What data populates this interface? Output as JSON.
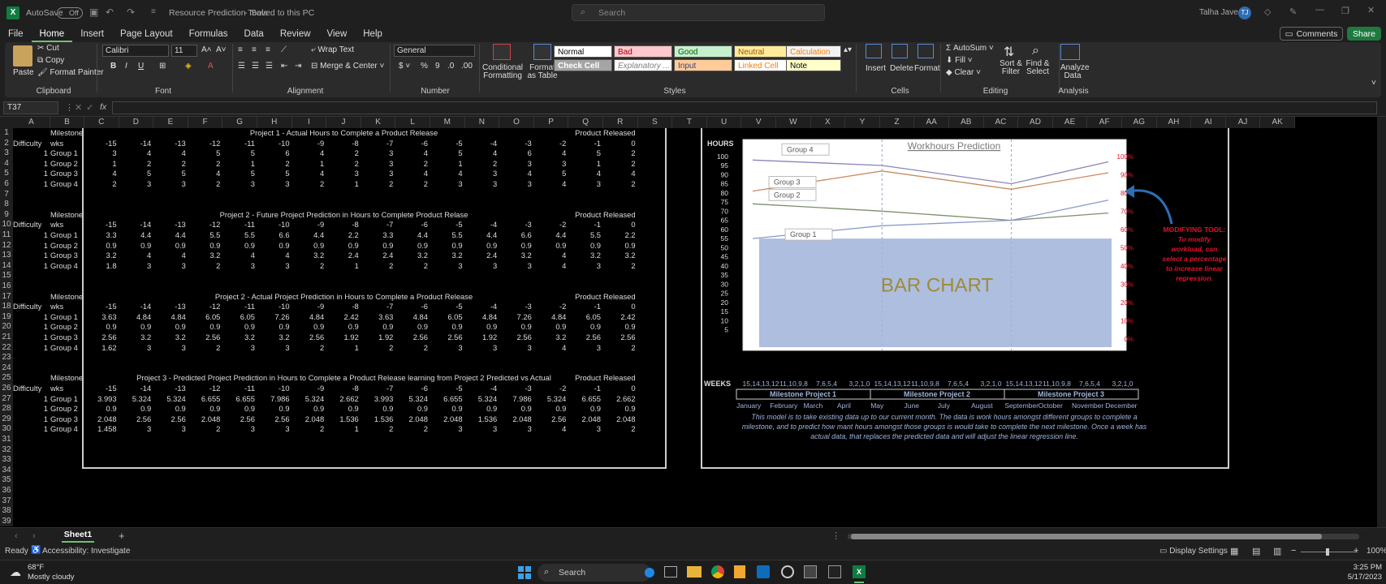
{
  "titlebar": {
    "autosave_label": "AutoSave",
    "autosave_state": "Off",
    "doc_title": "Resource Prediction Tools",
    "save_status": "Saved to this PC",
    "search_placeholder": "Search",
    "user_name": "Talha Javed",
    "user_initials": "TJ"
  },
  "menu": [
    "File",
    "Home",
    "Insert",
    "Page Layout",
    "Formulas",
    "Data",
    "Review",
    "View",
    "Help"
  ],
  "menu_active": "Home",
  "comments_label": "Comments",
  "share_label": "Share",
  "ribbon": {
    "clipboard": {
      "paste": "Paste",
      "cut": "Cut",
      "copy": "Copy",
      "format_painter": "Format Painter",
      "label": "Clipboard"
    },
    "font": {
      "family": "Calibri",
      "size": "11",
      "label": "Font"
    },
    "alignment": {
      "wrap": "Wrap Text",
      "merge": "Merge & Center",
      "label": "Alignment"
    },
    "number": {
      "format": "General",
      "label": "Number"
    },
    "styles": {
      "conditional": "Conditional Formatting",
      "format_table": "Format as Table",
      "label": "Styles",
      "cells": [
        "Normal",
        "Bad",
        "Good",
        "Neutral",
        "Calculation",
        "Check Cell",
        "Explanatory ...",
        "Input",
        "Linked Cell",
        "Note"
      ]
    },
    "cells": {
      "insert": "Insert",
      "delete": "Delete",
      "format": "Format",
      "label": "Cells"
    },
    "editing": {
      "autosum": "AutoSum",
      "fill": "Fill",
      "clear": "Clear",
      "sort": "Sort & Filter",
      "find": "Find & Select",
      "label": "Editing"
    },
    "analysis": {
      "analyze": "Analyze Data",
      "label": "Analysis"
    }
  },
  "formula": {
    "name_box": "T37",
    "fx": "fx",
    "value": ""
  },
  "columns": [
    "A",
    "B",
    "C",
    "D",
    "E",
    "F",
    "G",
    "H",
    "I",
    "J",
    "K",
    "L",
    "M",
    "N",
    "O",
    "P",
    "Q",
    "R",
    "S",
    "T",
    "U",
    "V",
    "W",
    "X",
    "Y",
    "Z",
    "AA",
    "AB",
    "AC",
    "AD",
    "AE",
    "AF",
    "AG",
    "AH",
    "AI",
    "AJ",
    "AK"
  ],
  "rows": [
    "1",
    "2",
    "3",
    "4",
    "5",
    "6",
    "7",
    "8",
    "9",
    "10",
    "11",
    "12",
    "13",
    "14",
    "15",
    "16",
    "17",
    "18",
    "19",
    "20",
    "21",
    "22",
    "23",
    "24",
    "25",
    "26",
    "27",
    "28",
    "29",
    "30",
    "31",
    "32",
    "33",
    "34",
    "35",
    "36",
    "37",
    "38",
    "39"
  ],
  "weeks": [
    "-15",
    "-14",
    "-13",
    "-12",
    "-11",
    "-10",
    "-9",
    "-8",
    "-7",
    "-6",
    "-5",
    "-4",
    "-3",
    "-2",
    "-1"
  ],
  "labels": {
    "milestone": "Milestone",
    "difficulty": "Difficulty",
    "wks": "wks",
    "released": "Product Released"
  },
  "tables": [
    {
      "title": "Project 1 - Actual Hours to Complete a  Product Release",
      "released_first": "0",
      "groups": [
        {
          "diff": "1",
          "name": "Group 1",
          "vals": [
            "3",
            "4",
            "4",
            "5",
            "5",
            "6",
            "4",
            "2",
            "3",
            "4",
            "5",
            "4",
            "6",
            "4",
            "5"
          ],
          "rel": "2"
        },
        {
          "diff": "1",
          "name": "Group 2",
          "vals": [
            "1",
            "2",
            "2",
            "2",
            "1",
            "2",
            "1",
            "2",
            "3",
            "2",
            "1",
            "2",
            "3",
            "3",
            "1"
          ],
          "rel": "2"
        },
        {
          "diff": "1",
          "name": "Group 3",
          "vals": [
            "4",
            "5",
            "5",
            "4",
            "5",
            "5",
            "4",
            "3",
            "3",
            "4",
            "4",
            "3",
            "4",
            "5",
            "4"
          ],
          "rel": "4"
        },
        {
          "diff": "1",
          "name": "Group 4",
          "vals": [
            "2",
            "3",
            "3",
            "2",
            "3",
            "3",
            "2",
            "1",
            "2",
            "2",
            "3",
            "3",
            "3",
            "4",
            "3"
          ],
          "rel": "2"
        }
      ]
    },
    {
      "title": "Project 2 - Future Project Prediction in Hours to Complete Product Relase",
      "released_first": "0",
      "groups": [
        {
          "diff": "1",
          "name": "Group 1",
          "vals": [
            "3.3",
            "4.4",
            "4.4",
            "5.5",
            "5.5",
            "6.6",
            "4.4",
            "2.2",
            "3.3",
            "4.4",
            "5.5",
            "4.4",
            "6.6",
            "4.4",
            "5.5"
          ],
          "rel": "2.2"
        },
        {
          "diff": "1",
          "name": "Group 2",
          "vals": [
            "0.9",
            "0.9",
            "0.9",
            "0.9",
            "0.9",
            "0.9",
            "0.9",
            "0.9",
            "0.9",
            "0.9",
            "0.9",
            "0.9",
            "0.9",
            "0.9",
            "0.9"
          ],
          "rel": "0.9"
        },
        {
          "diff": "1",
          "name": "Group 3",
          "vals": [
            "3.2",
            "4",
            "4",
            "3.2",
            "4",
            "4",
            "3.2",
            "2.4",
            "2.4",
            "3.2",
            "3.2",
            "2.4",
            "3.2",
            "4",
            "3.2"
          ],
          "rel": "3.2"
        },
        {
          "diff": "1",
          "name": "Group 4",
          "vals": [
            "1.8",
            "3",
            "3",
            "2",
            "3",
            "3",
            "2",
            "1",
            "2",
            "2",
            "3",
            "3",
            "3",
            "4",
            "3"
          ],
          "rel": "2"
        }
      ]
    },
    {
      "title": "Project 2 - Actual Project Prediction in Hours to Complete a Product Release",
      "released_first": "0",
      "groups": [
        {
          "diff": "1",
          "name": "Group 1",
          "vals": [
            "3.63",
            "4.84",
            "4.84",
            "6.05",
            "6.05",
            "7.26",
            "4.84",
            "2.42",
            "3.63",
            "4.84",
            "6.05",
            "4.84",
            "7.26",
            "4.84",
            "6.05"
          ],
          "rel": "2.42"
        },
        {
          "diff": "1",
          "name": "Group 2",
          "vals": [
            "0.9",
            "0.9",
            "0.9",
            "0.9",
            "0.9",
            "0.9",
            "0.9",
            "0.9",
            "0.9",
            "0.9",
            "0.9",
            "0.9",
            "0.9",
            "0.9",
            "0.9"
          ],
          "rel": "0.9"
        },
        {
          "diff": "1",
          "name": "Group 3",
          "vals": [
            "2.56",
            "3.2",
            "3.2",
            "2.56",
            "3.2",
            "3.2",
            "2.56",
            "1.92",
            "1.92",
            "2.56",
            "2.56",
            "1.92",
            "2.56",
            "3.2",
            "2.56"
          ],
          "rel": "2.56"
        },
        {
          "diff": "1",
          "name": "Group 4",
          "vals": [
            "1.62",
            "3",
            "3",
            "2",
            "3",
            "3",
            "2",
            "1",
            "2",
            "2",
            "3",
            "3",
            "3",
            "4",
            "3"
          ],
          "rel": "2"
        }
      ]
    },
    {
      "title": "Project 3 - Predicted Project Prediction in Hours to Complete a Product Release learning from Project 2 Predicted vs Actual",
      "released_first": "0",
      "groups": [
        {
          "diff": "1",
          "name": "Group 1",
          "vals": [
            "3.993",
            "5.324",
            "5.324",
            "6.655",
            "6.655",
            "7.986",
            "5.324",
            "2.662",
            "3.993",
            "5.324",
            "6.655",
            "5.324",
            "7.986",
            "5.324",
            "6.655"
          ],
          "rel": "2.662"
        },
        {
          "diff": "1",
          "name": "Group 2",
          "vals": [
            "0.9",
            "0.9",
            "0.9",
            "0.9",
            "0.9",
            "0.9",
            "0.9",
            "0.9",
            "0.9",
            "0.9",
            "0.9",
            "0.9",
            "0.9",
            "0.9",
            "0.9"
          ],
          "rel": "0.9"
        },
        {
          "diff": "1",
          "name": "Group 3",
          "vals": [
            "2.048",
            "2.56",
            "2.56",
            "2.048",
            "2.56",
            "2.56",
            "2.048",
            "1.536",
            "1.536",
            "2.048",
            "2.048",
            "1.536",
            "2.048",
            "2.56",
            "2.048"
          ],
          "rel": "2.048"
        },
        {
          "diff": "1",
          "name": "Group 4",
          "vals": [
            "1.458",
            "3",
            "3",
            "2",
            "3",
            "3",
            "2",
            "1",
            "2",
            "2",
            "3",
            "3",
            "3",
            "4",
            "3"
          ],
          "rel": "2"
        }
      ]
    }
  ],
  "chart_data": {
    "type": "line",
    "title": "Workhours Prediction",
    "ylabel": "HOURS",
    "xlabel": "WEEKS",
    "y_ticks": [
      "100",
      "95",
      "90",
      "85",
      "80",
      "75",
      "70",
      "65",
      "60",
      "55",
      "50",
      "45",
      "40",
      "35",
      "30",
      "25",
      "20",
      "15",
      "10",
      "5"
    ],
    "pct_ticks": [
      "100%",
      "90%",
      "80%",
      "70%",
      "60%",
      "50%",
      "40%",
      "30%",
      "20%",
      "10%",
      "0%"
    ],
    "week_labels": [
      "15,14,13,12",
      "11,10,9,8",
      "7,6,5,4",
      "3,2,1,0",
      "15,14,13,12",
      "11,10,9,8",
      "7,6,5,4",
      "3,2,1,0",
      "15,14,13,12",
      "11,10,9,8",
      "7,6,5,4",
      "3,2,1,0"
    ],
    "milestones": [
      "Milestone Project 1",
      "Milestone Project 2",
      "Milestone Project 3"
    ],
    "months": [
      "January",
      "February",
      "March",
      "April",
      "May",
      "June",
      "July",
      "August",
      "September",
      "October",
      "November",
      "December"
    ],
    "bar_placeholder": "BAR CHART",
    "series": [
      {
        "name": "Group 4",
        "color": "#8a86b8",
        "points": [
          [
            0,
            98
          ],
          [
            4,
            95
          ],
          [
            8,
            85
          ],
          [
            11,
            97
          ]
        ]
      },
      {
        "name": "Group 3",
        "color": "#c98a5e",
        "points": [
          [
            0,
            81
          ],
          [
            4,
            92
          ],
          [
            8,
            82
          ],
          [
            11,
            91
          ]
        ]
      },
      {
        "name": "Group 2",
        "color": "#7b8f6a",
        "points": [
          [
            0,
            74
          ],
          [
            4,
            70
          ],
          [
            8,
            65
          ],
          [
            11,
            69
          ]
        ]
      },
      {
        "name": "Group 1",
        "color": "#8a9ac8",
        "points": [
          [
            0,
            55
          ],
          [
            4,
            62
          ],
          [
            8,
            65
          ],
          [
            11,
            76
          ]
        ]
      }
    ],
    "x_range": [
      0,
      11
    ],
    "y_range": [
      0,
      103
    ],
    "divider_x": [
      4,
      8
    ]
  },
  "annotation": {
    "heading": "MODIFYING TOOL:",
    "lines": [
      "To modify",
      "workload, can",
      "select a percentage",
      "to increase linear",
      "regression."
    ],
    "color": "#e0142a"
  },
  "description": "This model is to take existing data up to our current month.  The data is work hours amongst different groups to complete a milestone, and to predict how mant hours amongst those groups is would take to complete the next milestone.  Once a week has actual data, that replaces the predicted data and will adjust the linear regression line.",
  "sheet": {
    "tab": "Sheet1"
  },
  "status": {
    "ready": "Ready",
    "accessibility": "Accessibility: Investigate",
    "display": "Display Settings",
    "zoom": "100%"
  },
  "taskbar": {
    "temp": "68°F",
    "weather": "Mostly cloudy",
    "search": "Search",
    "time": "3:25 PM",
    "date": "5/17/2023"
  }
}
